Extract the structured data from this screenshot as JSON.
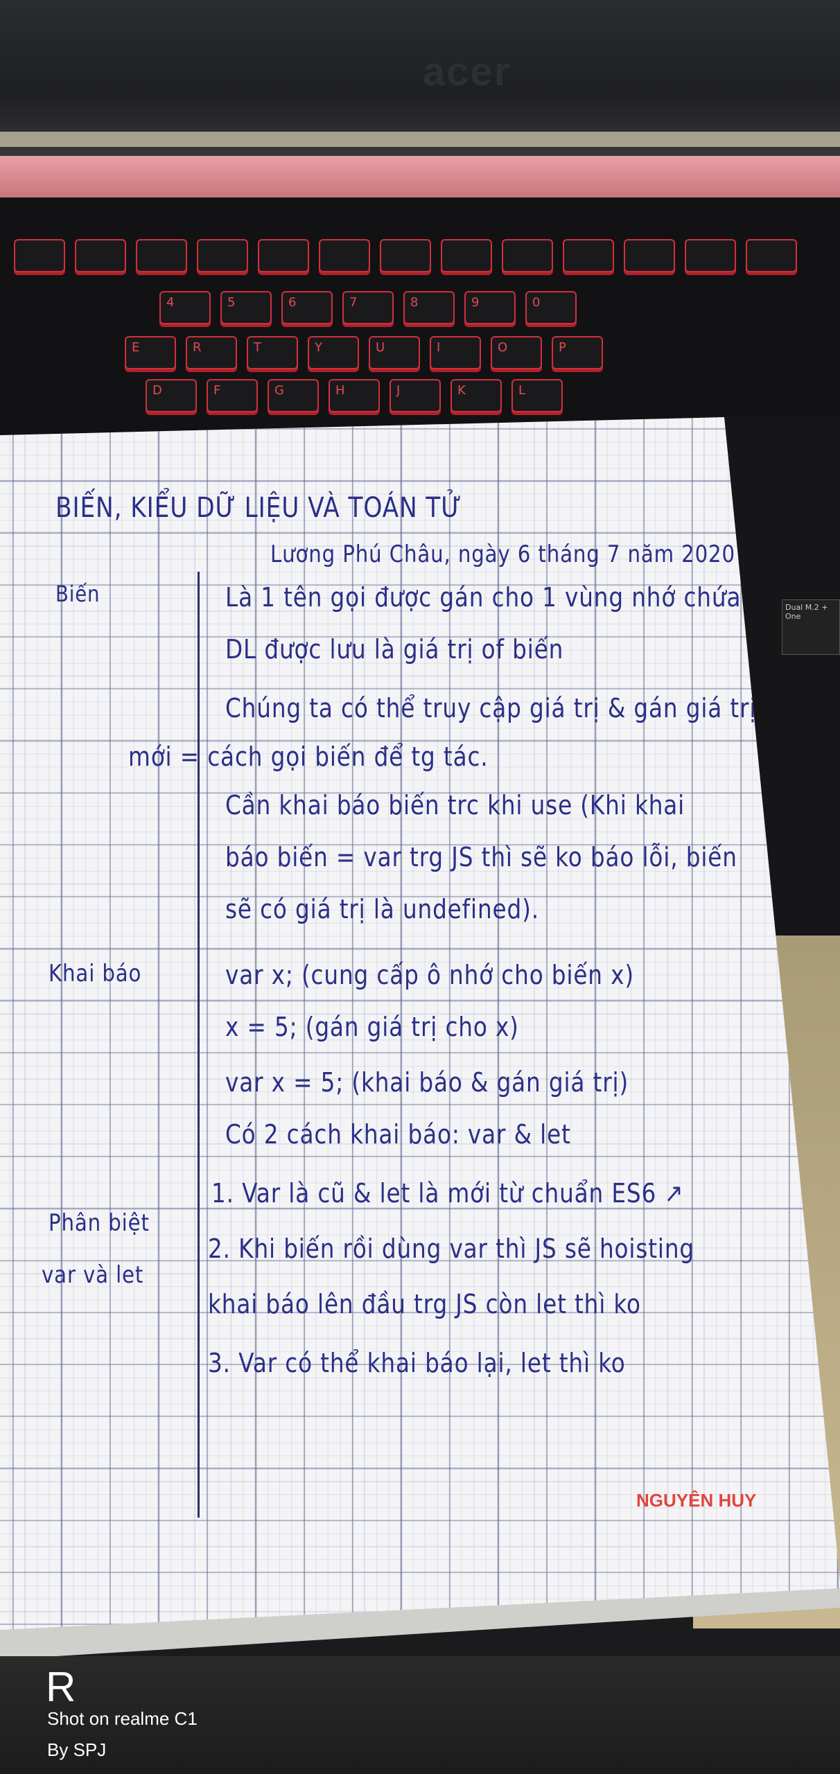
{
  "laptop": {
    "brand_logo": "acer",
    "sticker_text": "Dual M.2 + One"
  },
  "keyboard": {
    "keys_color": "#d2303a",
    "rows": [
      [
        "4",
        "5",
        "6",
        "7",
        "8",
        "9",
        "0"
      ],
      [
        "E",
        "R",
        "T",
        "Y",
        "U",
        "I",
        "O",
        "P"
      ],
      [
        "D",
        "F",
        "G",
        "H",
        "J",
        "K",
        "L"
      ]
    ]
  },
  "notebook": {
    "ink_color": "#2b2f86",
    "title": "BIẾN, KIỂU DỮ LIỆU VÀ TOÁN TỬ",
    "date_line": "Lương Phú Châu, ngày 6 tháng 7 năm 2020",
    "margin_labels": [
      "Biến",
      "Khai báo",
      "Phân biệt",
      "var và let"
    ],
    "lines": [
      "Là 1 tên gọi được gán cho 1 vùng nhớ chứa DL",
      "DL được lưu là giá trị of biến",
      "Chúng ta có thể truy cập giá trị & gán giá trị",
      "mới = cách gọi biến để tg tác.",
      "Cần khai báo biến trc khi use (Khi khai",
      "báo biến = var trg JS thì sẽ ko báo lỗi, biến",
      "sẽ có giá trị là undefined).",
      "var x; (cung cấp ô nhớ cho biến x)",
      "x = 5; (gán giá trị cho x)",
      "var x = 5; (khai báo & gán giá trị)",
      "Có 2 cách khai báo: var & let",
      "1. Var là cũ & let là mới từ chuẩn ES6 ↗",
      "2. Khi biến rồi dùng var thì JS sẽ hoisting",
      "khai báo lên đầu trg JS còn let thì ko",
      "3. Var có thể khai báo lại, let thì ko"
    ],
    "brand": "NGUYÊN HUY",
    "brand_color": "#e0463c"
  },
  "watermark": {
    "logo": "R",
    "line1": "Shot on realme C1",
    "line2": "By SPJ"
  }
}
